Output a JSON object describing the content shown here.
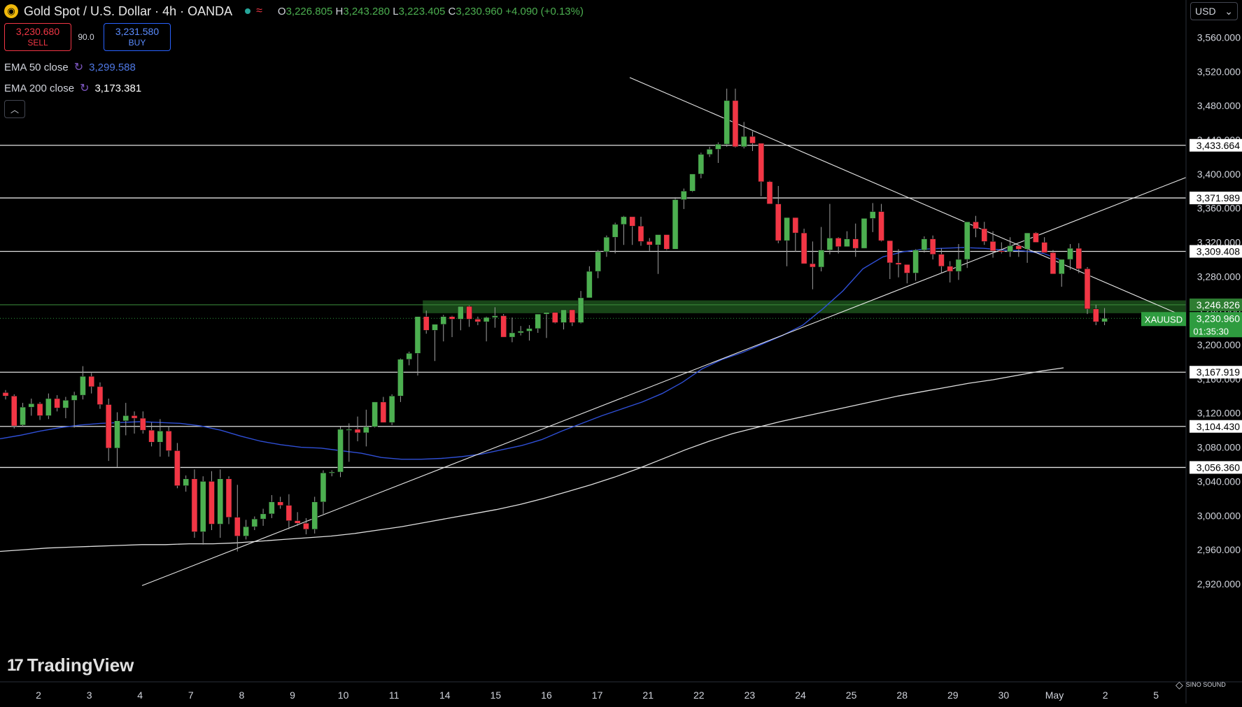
{
  "header": {
    "title": "Gold Spot / U.S. Dollar · 4h · OANDA",
    "logo_icon": "gold-coin-icon",
    "ohlc": {
      "o_label": "O",
      "o": "3,226.805",
      "h_label": "H",
      "h": "3,243.280",
      "l_label": "L",
      "l": "3,223.405",
      "c_label": "C",
      "c": "3,230.960",
      "change": "+4.090 (+0.13%)"
    }
  },
  "trade": {
    "sell_price": "3,230.680",
    "sell_label": "SELL",
    "spread": "90.0",
    "buy_price": "3,231.580",
    "buy_label": "BUY"
  },
  "indicators": [
    {
      "label": "EMA 50 close",
      "value": "3,299.588",
      "color": "#4f79e6"
    },
    {
      "label": "EMA 200 close",
      "value": "3,173.381",
      "color": "#ffffff"
    }
  ],
  "currency": "USD",
  "brand": "TradingView",
  "corner_brand": "SINO SOUND",
  "chart_data": {
    "type": "candlestick",
    "symbol": "XAUUSD",
    "timeframe": "4h",
    "ylim": [
      2880,
      3580
    ],
    "y_ticks": [
      2920,
      2960,
      3000,
      3040,
      3080,
      3120,
      3160,
      3200,
      3240,
      3280,
      3320,
      3360,
      3400,
      3440,
      3480,
      3520,
      3560
    ],
    "y_tick_labels": [
      "2,920.000",
      "2,960.000",
      "3,000.000",
      "3,040.000",
      "3,080.000",
      "3,120.000",
      "3,160.000",
      "3,200.000",
      "3,240.000",
      "3,280.000",
      "3,320.000",
      "3,360.000",
      "3,400.000",
      "3,440.000",
      "3,480.000",
      "3,520.000",
      "3,560.000"
    ],
    "x_labels": [
      "2",
      "3",
      "4",
      "7",
      "8",
      "9",
      "10",
      "11",
      "14",
      "15",
      "16",
      "17",
      "21",
      "22",
      "23",
      "24",
      "25",
      "28",
      "29",
      "30",
      "May",
      "2",
      "5"
    ],
    "x_label_index": [
      4,
      10,
      16,
      22,
      28,
      34,
      40,
      46,
      52,
      58,
      64,
      70,
      76,
      82,
      88,
      94,
      100,
      106,
      112,
      118,
      124,
      130,
      136
    ],
    "candles": [
      [
        3144,
        3147,
        3136,
        3140
      ],
      [
        3140,
        3142,
        3102,
        3105
      ],
      [
        3106,
        3132,
        3104,
        3127
      ],
      [
        3127,
        3137,
        3117,
        3131
      ],
      [
        3131,
        3133,
        3112,
        3117
      ],
      [
        3117,
        3143,
        3113,
        3137
      ],
      [
        3137,
        3141,
        3122,
        3126
      ],
      [
        3126,
        3139,
        3114,
        3135
      ],
      [
        3135,
        3145,
        3103,
        3141
      ],
      [
        3141,
        3175,
        3136,
        3163
      ],
      [
        3163,
        3167,
        3143,
        3151
      ],
      [
        3151,
        3156,
        3125,
        3130
      ],
      [
        3130,
        3137,
        3064,
        3079
      ],
      [
        3079,
        3121,
        3057,
        3111
      ],
      [
        3111,
        3132,
        3094,
        3117
      ],
      [
        3117,
        3122,
        3096,
        3114
      ],
      [
        3114,
        3122,
        3096,
        3100
      ],
      [
        3100,
        3109,
        3081,
        3086
      ],
      [
        3086,
        3113,
        3069,
        3099
      ],
      [
        3099,
        3105,
        3069,
        3076
      ],
      [
        3076,
        3085,
        3032,
        3035
      ],
      [
        3035,
        3047,
        3028,
        3043
      ],
      [
        3043,
        3054,
        2974,
        2981
      ],
      [
        2981,
        3046,
        2966,
        3040
      ],
      [
        3040,
        3052,
        2983,
        2990
      ],
      [
        2990,
        3054,
        2974,
        3043
      ],
      [
        3043,
        3046,
        2990,
        2998
      ],
      [
        2998,
        3036,
        2958,
        2976
      ],
      [
        2976,
        2995,
        2972,
        2987
      ],
      [
        2987,
        2999,
        2983,
        2996
      ],
      [
        2996,
        3008,
        2988,
        3002
      ],
      [
        3002,
        3024,
        2997,
        3016
      ],
      [
        3016,
        3022,
        3008,
        3012
      ],
      [
        3012,
        3025,
        2984,
        2994
      ],
      [
        2994,
        3004,
        2988,
        2991
      ],
      [
        2991,
        2997,
        2978,
        2984
      ],
      [
        2984,
        3022,
        2979,
        3016
      ],
      [
        3016,
        3053,
        3002,
        3050
      ],
      [
        3050,
        3053,
        3046,
        3051
      ],
      [
        3051,
        3104,
        3045,
        3101
      ],
      [
        3101,
        3108,
        3063,
        3101
      ],
      [
        3101,
        3116,
        3087,
        3097
      ],
      [
        3097,
        3124,
        3081,
        3104
      ],
      [
        3104,
        3133,
        3103,
        3133
      ],
      [
        3133,
        3139,
        3109,
        3109
      ],
      [
        3109,
        3142,
        3106,
        3140
      ],
      [
        3140,
        3184,
        3133,
        3183
      ],
      [
        3183,
        3192,
        3176,
        3190
      ],
      [
        3190,
        3233,
        3164,
        3233
      ],
      [
        3233,
        3240,
        3213,
        3217
      ],
      [
        3217,
        3224,
        3181,
        3224
      ],
      [
        3224,
        3235,
        3204,
        3233
      ],
      [
        3233,
        3234,
        3209,
        3230
      ],
      [
        3230,
        3241,
        3217,
        3245
      ],
      [
        3245,
        3246,
        3221,
        3230
      ],
      [
        3230,
        3233,
        3223,
        3227
      ],
      [
        3227,
        3233,
        3204,
        3232
      ],
      [
        3232,
        3244,
        3220,
        3234
      ],
      [
        3234,
        3236,
        3213,
        3209
      ],
      [
        3209,
        3232,
        3203,
        3214
      ],
      [
        3214,
        3222,
        3211,
        3216
      ],
      [
        3216,
        3223,
        3205,
        3219
      ],
      [
        3219,
        3233,
        3214,
        3236
      ],
      [
        3236,
        3237,
        3208,
        3238
      ],
      [
        3238,
        3236,
        3225,
        3226
      ],
      [
        3226,
        3241,
        3218,
        3241
      ],
      [
        3241,
        3236,
        3222,
        3226
      ],
      [
        3226,
        3263,
        3225,
        3255
      ],
      [
        3255,
        3292,
        3255,
        3286
      ],
      [
        3286,
        3311,
        3278,
        3309
      ],
      [
        3309,
        3328,
        3303,
        3326
      ],
      [
        3326,
        3343,
        3307,
        3341
      ],
      [
        3341,
        3351,
        3317,
        3350
      ],
      [
        3350,
        3346,
        3317,
        3339
      ],
      [
        3339,
        3350,
        3316,
        3321
      ],
      [
        3321,
        3325,
        3310,
        3317
      ],
      [
        3317,
        3325,
        3283,
        3329
      ],
      [
        3329,
        3327,
        3311,
        3312
      ],
      [
        3312,
        3373,
        3312,
        3370
      ],
      [
        3370,
        3383,
        3359,
        3380
      ],
      [
        3380,
        3399,
        3379,
        3400
      ],
      [
        3400,
        3425,
        3395,
        3423
      ],
      [
        3423,
        3432,
        3420,
        3429
      ],
      [
        3429,
        3437,
        3413,
        3435
      ],
      [
        3435,
        3500,
        3432,
        3486
      ],
      [
        3486,
        3500,
        3431,
        3432
      ],
      [
        3432,
        3461,
        3430,
        3444
      ],
      [
        3444,
        3450,
        3427,
        3436
      ],
      [
        3436,
        3434,
        3374,
        3391
      ],
      [
        3391,
        3392,
        3368,
        3365
      ],
      [
        3365,
        3386,
        3319,
        3322
      ],
      [
        3322,
        3341,
        3292,
        3349
      ],
      [
        3349,
        3339,
        3309,
        3331
      ],
      [
        3331,
        3336,
        3299,
        3295
      ],
      [
        3295,
        3321,
        3265,
        3291
      ],
      [
        3291,
        3338,
        3286,
        3311
      ],
      [
        3311,
        3365,
        3306,
        3325
      ],
      [
        3325,
        3326,
        3307,
        3315
      ],
      [
        3315,
        3333,
        3315,
        3324
      ],
      [
        3324,
        3342,
        3303,
        3313
      ],
      [
        3313,
        3347,
        3313,
        3348
      ],
      [
        3348,
        3366,
        3332,
        3356
      ],
      [
        3356,
        3365,
        3321,
        3322
      ],
      [
        3322,
        3319,
        3277,
        3296
      ],
      [
        3296,
        3312,
        3279,
        3294
      ],
      [
        3294,
        3294,
        3272,
        3284
      ],
      [
        3284,
        3312,
        3275,
        3311
      ],
      [
        3311,
        3327,
        3308,
        3324
      ],
      [
        3324,
        3328,
        3300,
        3306
      ],
      [
        3306,
        3313,
        3284,
        3292
      ],
      [
        3292,
        3298,
        3273,
        3286
      ],
      [
        3286,
        3318,
        3276,
        3300
      ],
      [
        3300,
        3324,
        3290,
        3344
      ],
      [
        3344,
        3351,
        3326,
        3336
      ],
      [
        3336,
        3344,
        3317,
        3321
      ],
      [
        3321,
        3333,
        3302,
        3310
      ],
      [
        3310,
        3320,
        3307,
        3309
      ],
      [
        3309,
        3326,
        3303,
        3316
      ],
      [
        3316,
        3312,
        3303,
        3312
      ],
      [
        3312,
        3327,
        3296,
        3331
      ],
      [
        3331,
        3332,
        3320,
        3320
      ],
      [
        3320,
        3326,
        3312,
        3308
      ],
      [
        3308,
        3311,
        3284,
        3283
      ],
      [
        3283,
        3292,
        3268,
        3300
      ],
      [
        3300,
        3318,
        3288,
        3313
      ],
      [
        3313,
        3319,
        3284,
        3289
      ],
      [
        3289,
        3291,
        3236,
        3242
      ],
      [
        3242,
        3247,
        3223,
        3227
      ],
      [
        3227,
        3243,
        3223,
        3231
      ]
    ],
    "ema50": [
      3090,
      3094,
      3099,
      3103,
      3106,
      3108,
      3109,
      3110,
      3109,
      3108,
      3105,
      3100,
      3093,
      3087,
      3083,
      3080,
      3079,
      3076,
      3073,
      3068,
      3066,
      3066,
      3067,
      3069,
      3072,
      3077,
      3082,
      3089,
      3099,
      3108,
      3117,
      3125,
      3133,
      3143,
      3156,
      3172,
      3183,
      3191,
      3201,
      3211,
      3223,
      3242,
      3263,
      3289,
      3303,
      3309,
      3312,
      3313,
      3314,
      3313,
      3311,
      3310,
      3307,
      3298
    ],
    "ema200": [
      2958,
      2960,
      2962,
      2963,
      2964,
      2965,
      2966,
      2966,
      2967,
      2967,
      2968,
      2970,
      2972,
      2974,
      2976,
      2979,
      2983,
      2987,
      2992,
      2997,
      3002,
      3007,
      3013,
      3020,
      3028,
      3036,
      3045,
      3055,
      3066,
      3077,
      3087,
      3096,
      3103,
      3110,
      3116,
      3122,
      3128,
      3134,
      3140,
      3145,
      3150,
      3155,
      3159,
      3164,
      3169,
      3173
    ],
    "horizontal_levels": [
      {
        "price": 3433.664,
        "label": "3,433.664"
      },
      {
        "price": 3371.989,
        "label": "3,371.989"
      },
      {
        "price": 3309.408,
        "label": "3,309.408"
      },
      {
        "price": 3167.919,
        "label": "3,167.919"
      },
      {
        "price": 3104.43,
        "label": "3,104.430"
      },
      {
        "price": 3056.36,
        "label": "3,056.360"
      }
    ],
    "zone": {
      "top": 3252,
      "bottom": 3237,
      "start_index": 49
    },
    "zone_label": "3,246.826",
    "zone_label_price": 3246.826,
    "last_price": {
      "label": "3,230.960",
      "price": 3230.96,
      "countdown": "01:35:30",
      "symbol_tag": "XAUUSD"
    },
    "trendlines": [
      {
        "from": [
          16,
          3513
        ],
        "to": [
          135,
          3236
        ]
      },
      {
        "from": [
          0,
          2918
        ],
        "to": [
          137,
          3396
        ]
      }
    ],
    "colors": {
      "up": "#4caf50",
      "down": "#f23645",
      "ema50": "#2f4fd6",
      "ema200": "#e0e0e0",
      "level": "#e0e0e0",
      "zone": "#1b4d1b",
      "label_bg": "#ffffff",
      "price_tag": "#2e9c3f"
    }
  }
}
